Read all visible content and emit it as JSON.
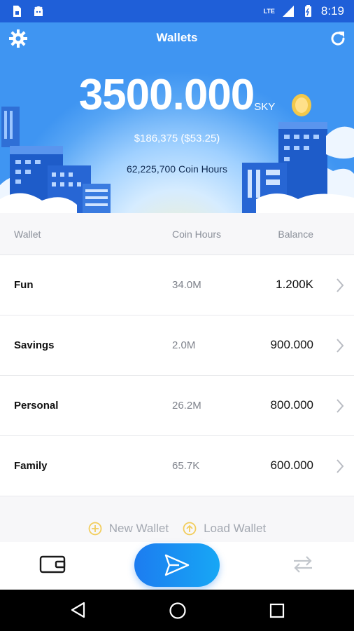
{
  "status_bar": {
    "time": "8:19",
    "network": "LTE",
    "battery_icon": "battery-icon",
    "left_icons": [
      "sim-card-icon",
      "android-icon"
    ]
  },
  "header": {
    "title": "Wallets",
    "total_balance": "3500.000",
    "unit": "SKY",
    "usd_value": "$186,375 ($53.25)",
    "coin_hours": "62,225,700 Coin Hours",
    "accent_color": "#3f95f2"
  },
  "table": {
    "columns": {
      "wallet": "Wallet",
      "coin_hours": "Coin Hours",
      "balance": "Balance"
    },
    "rows": [
      {
        "name": "Fun",
        "hours": "34.0M",
        "balance": "1.200K"
      },
      {
        "name": "Savings",
        "hours": "2.0M",
        "balance": "900.000"
      },
      {
        "name": "Personal",
        "hours": "26.2M",
        "balance": "800.000"
      },
      {
        "name": "Family",
        "hours": "65.7K",
        "balance": "600.000"
      }
    ]
  },
  "actions": {
    "new_wallet": "New Wallet",
    "load_wallet": "Load Wallet",
    "icon_color": "#f2cd5c"
  },
  "bottom_nav": {
    "icons": [
      "wallet-icon",
      "send-icon",
      "transfer-icon"
    ],
    "send_gradient": [
      "#1c7cf0",
      "#17a7f5"
    ]
  }
}
